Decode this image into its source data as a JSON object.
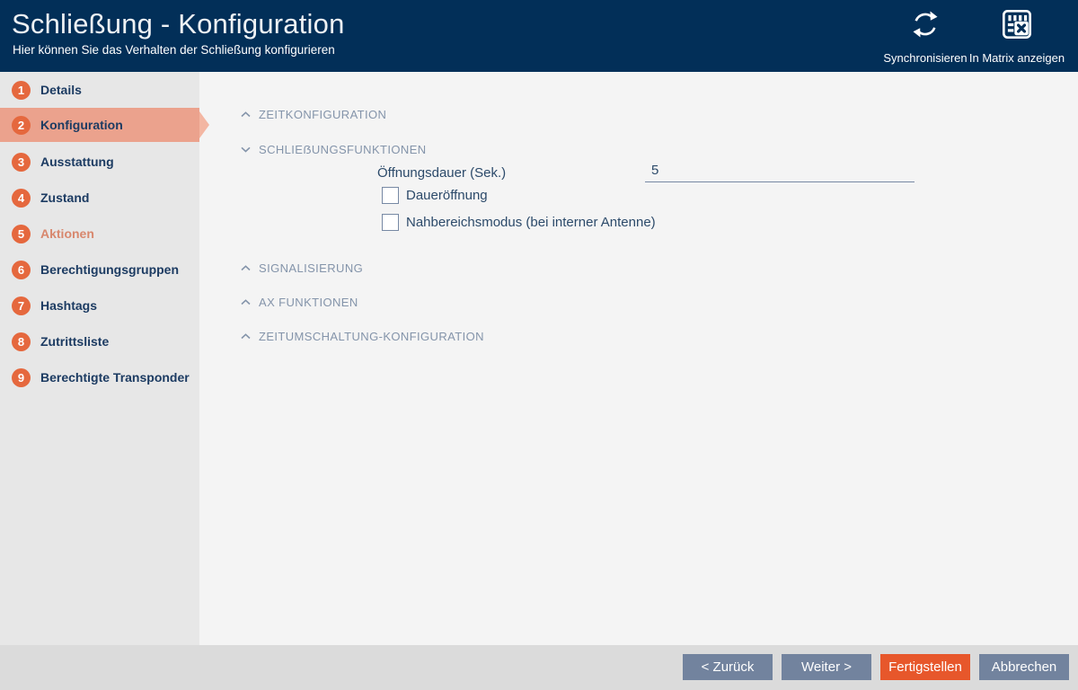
{
  "header": {
    "title": "Schließung - Konfiguration",
    "subtitle": "Hier können Sie das Verhalten der Schließung konfigurieren",
    "actions": [
      {
        "label": "Synchronisieren",
        "icon": "sync-icon"
      },
      {
        "label": "In Matrix anzeigen",
        "icon": "matrix-icon"
      }
    ]
  },
  "sidebar": {
    "items": [
      {
        "number": "1",
        "label": "Details",
        "active": false
      },
      {
        "number": "2",
        "label": "Konfiguration",
        "active": true
      },
      {
        "number": "3",
        "label": "Ausstattung",
        "active": false
      },
      {
        "number": "4",
        "label": "Zustand",
        "active": false
      },
      {
        "number": "5",
        "label": "Aktionen",
        "active": false,
        "accent_text": true
      },
      {
        "number": "6",
        "label": "Berechtigungsgruppen",
        "active": false
      },
      {
        "number": "7",
        "label": "Hashtags",
        "active": false
      },
      {
        "number": "8",
        "label": "Zutrittsliste",
        "active": false
      },
      {
        "number": "9",
        "label": "Berechtigte Transponder",
        "active": false
      }
    ]
  },
  "sections": [
    {
      "label": "ZEITKONFIGURATION",
      "state": "collapsed"
    },
    {
      "label": "SCHLIEẞUNGSFUNKTIONEN",
      "state": "expanded"
    },
    {
      "label": "SIGNALISIERUNG",
      "state": "collapsed"
    },
    {
      "label": "AX FUNKTIONEN",
      "state": "collapsed"
    },
    {
      "label": "ZEITUMSCHALTUNG-KONFIGURATION",
      "state": "collapsed"
    }
  ],
  "form": {
    "opening_duration_label": "Öffnungsdauer (Sek.)",
    "opening_duration_value": "5",
    "checkboxes": [
      {
        "label": "Daueröffnung",
        "checked": false
      },
      {
        "label": "Nahbereichsmodus (bei interner Antenne)",
        "checked": false
      }
    ]
  },
  "footer": {
    "buttons": [
      {
        "label": "< Zurück",
        "style": "gray"
      },
      {
        "label": "Weiter >",
        "style": "gray"
      },
      {
        "label": "Fertigstellen",
        "style": "orange"
      },
      {
        "label": "Abbrechen",
        "style": "gray"
      }
    ]
  },
  "colors": {
    "header_bg": "#022f58",
    "accent_orange": "#e5683e",
    "button_orange": "#e7572b",
    "active_row": "#eba28d",
    "button_gray_blue": "#72839e",
    "section_header_text": "#8494aa",
    "navy_text": "#1c3b62"
  }
}
